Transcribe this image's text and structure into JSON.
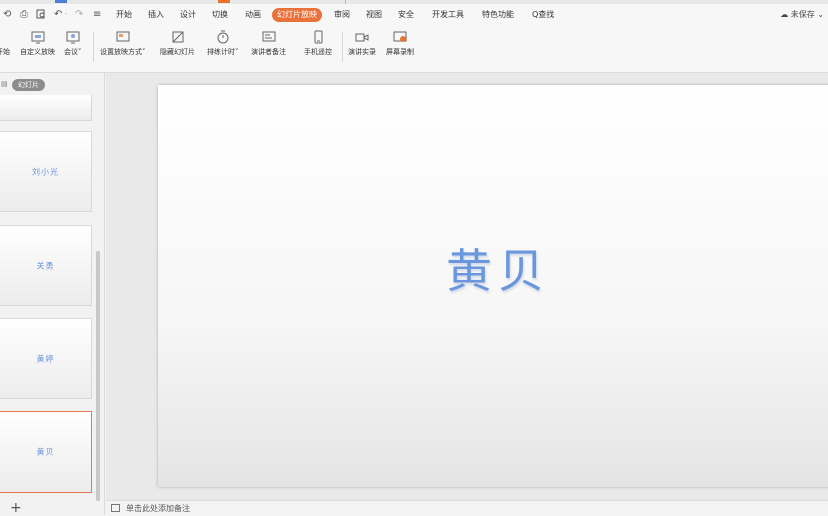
{
  "menubar": {
    "quick_access": [
      "⟲",
      "⎙",
      "🔍",
      "↶",
      "·",
      "↷",
      "≡"
    ],
    "items": [
      "开始",
      "插入",
      "设计",
      "切换",
      "动画",
      "幻灯片放映",
      "审阅",
      "视图",
      "安全",
      "开发工具",
      "特色功能"
    ],
    "active_index": 5,
    "search_label": "Q查找",
    "save_status": "未保存"
  },
  "ribbon": {
    "buttons": [
      {
        "label": "开始"
      },
      {
        "label": "自定义放映"
      },
      {
        "label": "会议"
      },
      {
        "label": "设置放映方式"
      },
      {
        "label": "隐藏幻灯片"
      },
      {
        "label": "排练计时"
      },
      {
        "label": "演讲者备注"
      },
      {
        "label": "手机遥控"
      },
      {
        "label": "演讲实录"
      },
      {
        "label": "屏幕录制"
      }
    ]
  },
  "left_panel": {
    "tab_label": "幻灯片",
    "slides": [
      "刘小光",
      "关勇",
      "黄婷",
      "黄贝"
    ],
    "selected_index": 3,
    "add_label": "+"
  },
  "slide": {
    "title": "黄贝"
  },
  "notes": {
    "placeholder": "单击此处添加备注"
  },
  "colors": {
    "accent": "#e9713a",
    "title_blue": "#6a97dc"
  }
}
